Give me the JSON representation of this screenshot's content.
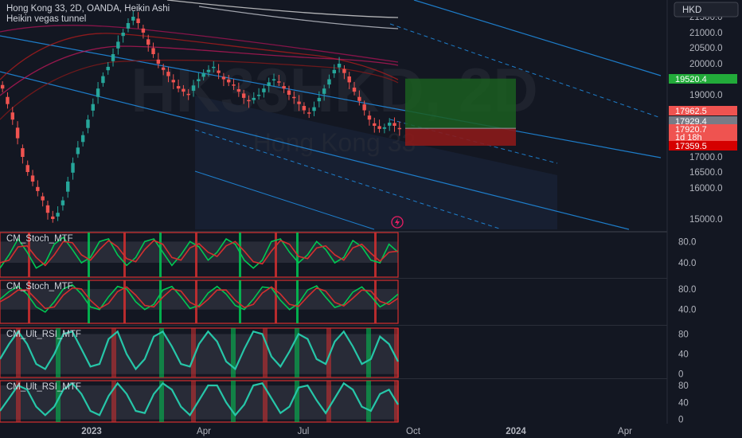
{
  "header": {
    "symbol_line": "Hong Kong 33, 2D, OANDA, Heikin Ashi",
    "indicator": "Heikin vegas tunnel",
    "currency": "HKD"
  },
  "watermark": {
    "ticker": "HK33HKD, 2D",
    "name": "Hong Kong 33"
  },
  "colors": {
    "background": "#131722",
    "up": "#26a69a",
    "down": "#ef5350",
    "channel": "#2196f3",
    "profit_zone": "#1b5e20",
    "loss_zone": "#8b1a1a",
    "stoch_green": "#00c853",
    "stoch_red": "#d32f2f",
    "rsi_line": "#26c6a8"
  },
  "chart_data": [
    {
      "type": "line",
      "panel": "price",
      "title": "Hong Kong 33, 2D, OANDA, Heikin Ashi",
      "ylim": [
        14600,
        21800
      ],
      "y_ticks": [
        "21500.0",
        "21000.0",
        "20500.0",
        "20000.0",
        "19000.0",
        "18000.0",
        "17000.0",
        "16500.0",
        "16000.0",
        "15000.0"
      ],
      "x_ticks": [
        "2023",
        "Apr",
        "Jul",
        "Oct",
        "2024",
        "Apr"
      ],
      "series": [
        {
          "name": "Hong Kong 33",
          "style": "heikin-ashi",
          "close_values": [
            19200,
            18700,
            18200,
            17600,
            17000,
            16500,
            16200,
            15900,
            15600,
            15200,
            15000,
            15200,
            15600,
            16200,
            16800,
            17300,
            17700,
            18200,
            18700,
            19200,
            19600,
            19900,
            20300,
            20700,
            21000,
            21300,
            21500,
            21300,
            21000,
            20600,
            20300,
            20000,
            19800,
            19600,
            19400,
            19200,
            19100,
            19000,
            19300,
            19500,
            19700,
            19800,
            19900,
            19700,
            19500,
            19400,
            19300,
            19100,
            18900,
            18800,
            18900,
            19000,
            19200,
            19400,
            19500,
            19400,
            19200,
            19000,
            18900,
            18700,
            18500,
            18400,
            18600,
            18900,
            19200,
            19500,
            19800,
            20000,
            19700,
            19400,
            19100,
            18800,
            18500,
            18200,
            18000,
            17900,
            17950,
            18100,
            18000,
            17900
          ]
        }
      ],
      "price_labels": [
        {
          "label": "19520.4",
          "color": "#22ab3a"
        },
        {
          "label": "17962.5",
          "color": "#ef5350"
        },
        {
          "label": "17929.4",
          "color": "#787b86"
        },
        {
          "label": "17920.7",
          "color": "#ef5350"
        },
        {
          "label": "1d 18h",
          "color": "#ef5350"
        },
        {
          "label": "17359.5",
          "color": "#d50000"
        }
      ],
      "position": {
        "entry": 17920.7,
        "target": 19520.4,
        "stop": 17359.5
      }
    },
    {
      "type": "line",
      "panel": "oscillator",
      "title": "CM_Stoch_MTF",
      "ylim": [
        10,
        100
      ],
      "y_ticks": [
        "80.0",
        "40.0"
      ],
      "series": [
        {
          "name": "k",
          "values": [
            30,
            55,
            85,
            60,
            30,
            40,
            75,
            88,
            65,
            40,
            50,
            80,
            85,
            55,
            35,
            50,
            80,
            85,
            60,
            35,
            55,
            80,
            70,
            45,
            60,
            85,
            75,
            45,
            30,
            45,
            80,
            85,
            60,
            40,
            55,
            80,
            65,
            40,
            50,
            82,
            70,
            45,
            40,
            75,
            60
          ]
        },
        {
          "name": "d",
          "values": [
            40,
            45,
            70,
            72,
            50,
            35,
            55,
            80,
            78,
            55,
            45,
            65,
            82,
            70,
            48,
            42,
            65,
            82,
            75,
            50,
            45,
            68,
            76,
            60,
            52,
            72,
            80,
            62,
            42,
            38,
            62,
            82,
            75,
            52,
            48,
            68,
            72,
            55,
            45,
            68,
            75,
            58,
            43,
            60,
            62
          ]
        }
      ]
    },
    {
      "type": "line",
      "panel": "oscillator",
      "title": "CM_Stoch_MTF",
      "ylim": [
        10,
        100
      ],
      "y_ticks": [
        "80.0",
        "40.0"
      ],
      "series": [
        {
          "name": "k",
          "values": [
            60,
            75,
            85,
            70,
            45,
            35,
            55,
            80,
            88,
            70,
            45,
            40,
            65,
            85,
            80,
            55,
            40,
            50,
            78,
            85,
            65,
            42,
            48,
            72,
            85,
            70,
            48,
            40,
            60,
            84,
            82,
            58,
            40,
            52,
            78,
            86,
            64,
            44,
            50,
            74,
            84,
            66,
            45,
            55,
            70
          ]
        },
        {
          "name": "d",
          "values": [
            55,
            65,
            78,
            78,
            60,
            42,
            45,
            68,
            82,
            80,
            58,
            42,
            52,
            75,
            84,
            68,
            48,
            45,
            64,
            80,
            76,
            54,
            45,
            60,
            78,
            78,
            58,
            44,
            50,
            72,
            84,
            70,
            50,
            46,
            65,
            82,
            76,
            54,
            47,
            62,
            78,
            76,
            56,
            50,
            62
          ]
        }
      ]
    },
    {
      "type": "line",
      "panel": "oscillator",
      "title": "CM_Ult_RSI_MTF",
      "ylim": [
        -10,
        95
      ],
      "y_ticks": [
        "80",
        "40",
        "0"
      ],
      "series": [
        {
          "name": "rsi",
          "values": [
            30,
            60,
            85,
            60,
            20,
            10,
            40,
            80,
            85,
            50,
            15,
            20,
            70,
            85,
            40,
            10,
            30,
            75,
            85,
            55,
            20,
            15,
            60,
            85,
            65,
            25,
            10,
            50,
            85,
            80,
            35,
            15,
            45,
            80,
            70,
            30,
            20,
            65,
            85,
            55,
            20,
            30,
            75,
            60,
            25
          ]
        }
      ]
    },
    {
      "type": "line",
      "panel": "oscillator",
      "title": "CM_Ult_RSI_MTF",
      "ylim": [
        -10,
        95
      ],
      "y_ticks": [
        "80",
        "40",
        "0"
      ],
      "series": [
        {
          "name": "rsi",
          "values": [
            20,
            50,
            80,
            70,
            30,
            10,
            30,
            70,
            85,
            60,
            20,
            10,
            55,
            85,
            60,
            20,
            15,
            60,
            85,
            70,
            30,
            10,
            45,
            80,
            80,
            40,
            10,
            35,
            80,
            85,
            50,
            15,
            30,
            75,
            80,
            45,
            15,
            50,
            85,
            70,
            30,
            20,
            60,
            70,
            35
          ]
        }
      ]
    }
  ]
}
